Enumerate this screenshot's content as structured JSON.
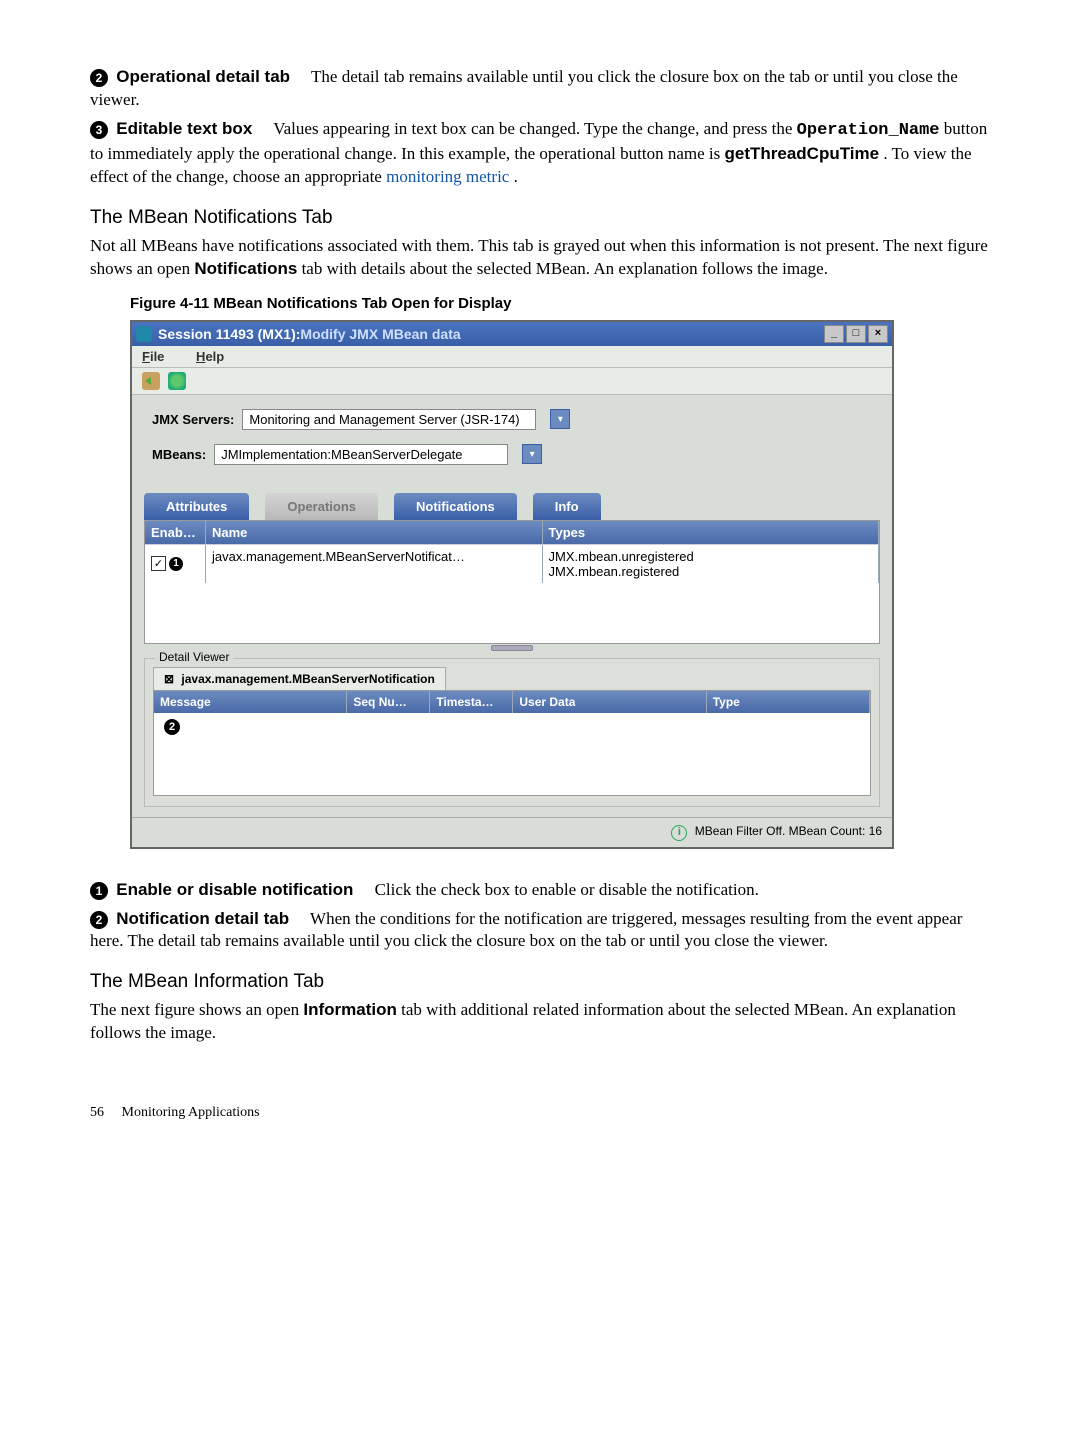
{
  "para2": {
    "num": "❷",
    "label": "Operational detail tab",
    "text": "The detail tab remains available until you click the closure box on the tab or until you close the viewer."
  },
  "para3": {
    "num": "❸",
    "label": "Editable text box",
    "text_a": "Values appearing in text box can be changed. Type the change, and press the ",
    "mono": "Operation_Name",
    "text_b": " button to immediately apply the operational change. In this example, the operational button name is ",
    "bold": "getThreadCpuTime",
    "text_c": " . To view the effect of the change, choose an appropriate ",
    "link": "monitoring metric",
    "text_d": "."
  },
  "section_notifications": "The MBean Notifications Tab",
  "notifications_intro_a": "Not all MBeans have notifications associated with them. This tab is grayed out when this information is not present. The next figure shows an open ",
  "notifications_intro_bold": "Notifications",
  "notifications_intro_b": " tab with details about the selected MBean. An explanation follows the image.",
  "fig_caption": "Figure 4-11 MBean Notifications Tab Open for Display",
  "window": {
    "title_a": "Session 11493 (MX1): ",
    "title_b": "Modify JMX MBean data",
    "min": "_",
    "max": "□",
    "close": "×",
    "menu_file": "File",
    "menu_help": "Help",
    "jmx_label": "JMX Servers:",
    "jmx_value": "Monitoring and Management Server (JSR-174)",
    "mbeans_label": "MBeans:",
    "mbeans_value": "JMImplementation:MBeanServerDelegate",
    "tabs": {
      "attributes": "Attributes",
      "operations": "Operations",
      "notifications": "Notifications",
      "info": "Info"
    },
    "table": {
      "h_enab": "Enab…",
      "h_name": "Name",
      "h_types": "Types",
      "row0_callout": "❶",
      "row0_name": "javax.management.MBeanServerNotificat…",
      "row0_types_a": "JMX.mbean.unregistered",
      "row0_types_b": "JMX.mbean.registered"
    },
    "detail": {
      "legend": "Detail Viewer",
      "tab_close": "⊠",
      "tab_title": "javax.management.MBeanServerNotification",
      "h_msg": "Message",
      "h_seq": "Seq Nu…",
      "h_ts": "Timesta…",
      "h_ud": "User Data",
      "h_type": "Type",
      "blank_callout": "❷"
    },
    "status": "MBean Filter Off. MBean Count: 16"
  },
  "callout1": {
    "num": "❶",
    "label": "Enable or disable notification",
    "text": "Click the check box to enable or disable the notification."
  },
  "callout2": {
    "num": "❷",
    "label": "Notification detail tab",
    "text": "When the conditions for the notification are triggered, messages resulting from the event appear here. The detail tab remains available until you click the closure box on the tab or until you close the viewer."
  },
  "section_info": "The MBean Information Tab",
  "info_intro_a": "The next figure shows an open ",
  "info_intro_bold": "Information",
  "info_intro_b": " tab with additional related information about the selected MBean. An explanation follows the image.",
  "footer_page": "56",
  "footer_text": "Monitoring Applications"
}
